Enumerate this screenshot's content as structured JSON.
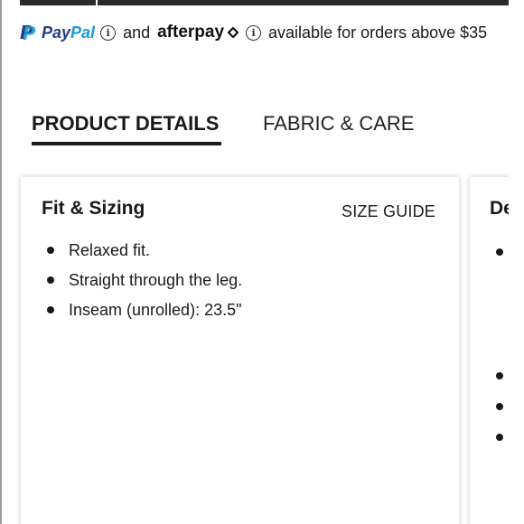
{
  "payment": {
    "paypal_pay": "Pay",
    "paypal_pal": "Pal",
    "and_text": "and",
    "afterpay_text": "afterpay",
    "tail_text": "available for orders above $35",
    "info_icon_glyph": "i",
    "paypal_colors": {
      "dark": "#253b80",
      "light": "#179bd7"
    }
  },
  "tabs": [
    {
      "label": "PRODUCT DETAILS",
      "active": true
    },
    {
      "label": "FABRIC & CARE",
      "active": false
    }
  ],
  "fit_card": {
    "title": "Fit & Sizing",
    "size_guide_label": "SIZE GUIDE",
    "bullets": [
      "Relaxed fit.",
      "Straight through the leg.",
      "Inseam (unrolled): 23.5\""
    ]
  },
  "second_card": {
    "title_partial": "De"
  }
}
